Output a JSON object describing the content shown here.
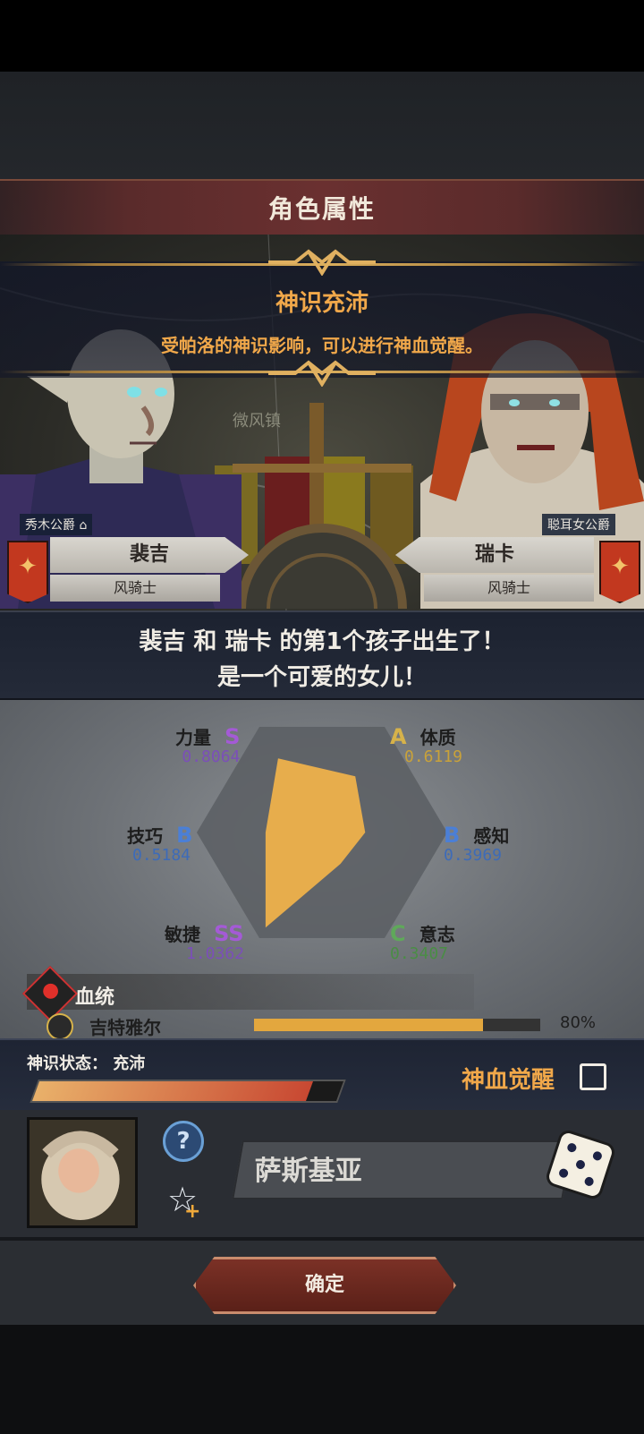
{
  "screen": {
    "title": "角色属性",
    "event": {
      "title": "神识充沛",
      "subtitle": "受帕洛的神识影响，可以进行神血觉醒。"
    },
    "map_label": "微风镇"
  },
  "left_parent": {
    "title": "秀木公爵",
    "name": "裴吉",
    "role": "风骑士"
  },
  "right_parent": {
    "title": "聪耳女公爵",
    "name": "瑞卡",
    "role": "风骑士"
  },
  "announcement": {
    "line1": "裴吉 和 瑞卡 的第1个孩子出生了！",
    "line2": "是一个可爱的女儿！"
  },
  "stats": [
    {
      "name": "力量",
      "grade": "S",
      "value": "0.8064",
      "grade_color": "#a45ad6"
    },
    {
      "name": "体质",
      "grade": "A",
      "value": "0.6119",
      "grade_color": "#d6b24a"
    },
    {
      "name": "感知",
      "grade": "B",
      "value": "0.3969",
      "grade_color": "#4b7fd6"
    },
    {
      "name": "意志",
      "grade": "C",
      "value": "0.3407",
      "grade_color": "#5fa85a"
    },
    {
      "name": "敏捷",
      "grade": "SS",
      "value": "1.0362",
      "grade_color": "#a45ad6"
    },
    {
      "name": "技巧",
      "grade": "B",
      "value": "0.5184",
      "grade_color": "#4b7fd6"
    }
  ],
  "radar": {
    "levels": [
      0.8064,
      0.6119,
      0.3969,
      0.3407,
      1.0362,
      0.5184
    ],
    "fill_color": "#e7ad4c"
  },
  "bloodline": {
    "label": "血统",
    "entry_name": "吉特雅尔",
    "entry_percent": "80%",
    "entry_fill": 0.8
  },
  "divine_state": {
    "label": "神识状态：",
    "value": "充沛",
    "level": 0.9
  },
  "awakening": {
    "label": "神血觉醒",
    "checked": false
  },
  "child": {
    "name": "萨斯基亚",
    "help_icon": "question-icon",
    "trait_icon": "star-plus-icon",
    "dice_icon": "dice-icon"
  },
  "confirm_label": "确定"
}
